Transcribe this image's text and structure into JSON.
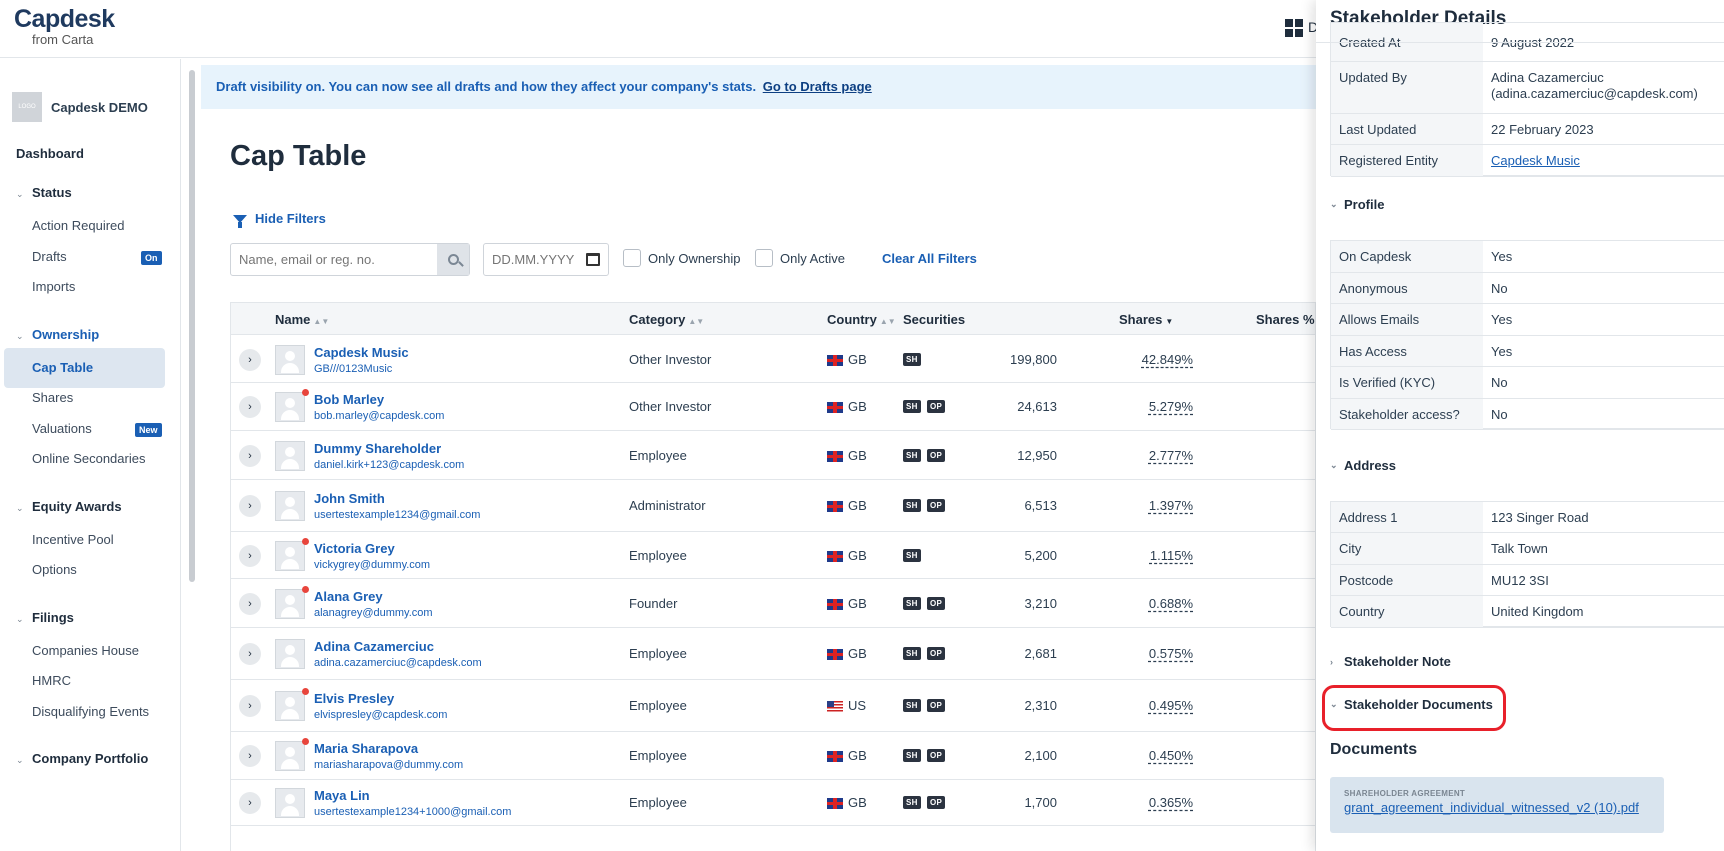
{
  "header": {
    "logo_main": "Capdesk",
    "logo_sub": "from Carta",
    "dash_label": "D"
  },
  "sidebar": {
    "company_logo": "LOGO",
    "company_name": "Capdesk DEMO",
    "dashboard": "Dashboard",
    "status": "Status",
    "action_required": "Action Required",
    "drafts": "Drafts",
    "drafts_badge": "On",
    "imports": "Imports",
    "ownership": "Ownership",
    "cap_table": "Cap Table",
    "shares": "Shares",
    "valuations": "Valuations",
    "valuations_badge": "New",
    "online_secondaries": "Online Secondaries",
    "equity_awards": "Equity Awards",
    "incentive_pool": "Incentive Pool",
    "options": "Options",
    "filings": "Filings",
    "companies_house": "Companies House",
    "hmrc": "HMRC",
    "disqualifying_events": "Disqualifying Events",
    "company_portfolio": "Company Portfolio"
  },
  "banner": {
    "text": "Draft visibility on. You can now see all drafts and how they affect your company's stats.",
    "link": "Go to Drafts page"
  },
  "main": {
    "title": "Cap Table",
    "hide_filters": "Hide Filters",
    "search_placeholder": "Name, email or reg. no.",
    "date_placeholder": "DD.MM.YYYY",
    "only_ownership": "Only Ownership",
    "only_active": "Only Active",
    "clear_filters": "Clear All Filters"
  },
  "table": {
    "columns": {
      "name": "Name",
      "category": "Category",
      "country": "Country",
      "securities": "Securities",
      "shares": "Shares",
      "shares_pct": "Shares %"
    },
    "rows": [
      {
        "name": "Capdesk Music",
        "sub": "GB///0123Music",
        "category": "Other Investor",
        "country": "GB",
        "secs": [
          "SH"
        ],
        "shares": "199,800",
        "pct": "42.849%"
      },
      {
        "name": "Bob Marley",
        "sub": "bob.marley@capdesk.com",
        "category": "Other Investor",
        "country": "GB",
        "secs": [
          "SH",
          "OP"
        ],
        "shares": "24,613",
        "pct": "5.279%"
      },
      {
        "name": "Dummy Shareholder",
        "sub": "daniel.kirk+123@capdesk.com",
        "category": "Employee",
        "country": "GB",
        "secs": [
          "SH",
          "OP"
        ],
        "shares": "12,950",
        "pct": "2.777%"
      },
      {
        "name": "John Smith",
        "sub": "usertestexample1234@gmail.com",
        "category": "Administrator",
        "country": "GB",
        "secs": [
          "SH",
          "OP"
        ],
        "shares": "6,513",
        "pct": "1.397%"
      },
      {
        "name": "Victoria Grey",
        "sub": "vickygrey@dummy.com",
        "category": "Employee",
        "country": "GB",
        "secs": [
          "SH"
        ],
        "shares": "5,200",
        "pct": "1.115%"
      },
      {
        "name": "Alana Grey",
        "sub": "alanagrey@dummy.com",
        "category": "Founder",
        "country": "GB",
        "secs": [
          "SH",
          "OP"
        ],
        "shares": "3,210",
        "pct": "0.688%"
      },
      {
        "name": "Adina Cazamerciuc",
        "sub": "adina.cazamerciuc@capdesk.com",
        "category": "Employee",
        "country": "GB",
        "secs": [
          "SH",
          "OP"
        ],
        "shares": "2,681",
        "pct": "0.575%"
      },
      {
        "name": "Elvis Presley",
        "sub": "elvispresley@capdesk.com",
        "category": "Employee",
        "country": "US",
        "secs": [
          "SH",
          "OP"
        ],
        "shares": "2,310",
        "pct": "0.495%"
      },
      {
        "name": "Maria Sharapova",
        "sub": "mariasharapova@dummy.com",
        "category": "Employee",
        "country": "GB",
        "secs": [
          "SH",
          "OP"
        ],
        "shares": "2,100",
        "pct": "0.450%"
      },
      {
        "name": "Maya Lin",
        "sub": "usertestexample1234+1000@gmail.com",
        "category": "Employee",
        "country": "GB",
        "secs": [
          "SH",
          "OP"
        ],
        "shares": "1,700",
        "pct": "0.365%"
      }
    ]
  },
  "panel": {
    "title": "Stakeholder Details",
    "top_rows": [
      {
        "k": "Created At",
        "v": "9 August 2022"
      },
      {
        "k": "Updated By",
        "v": "Adina Cazamerciuc",
        "v2": "(adina.cazamerciuc@capdesk.com)"
      },
      {
        "k": "Last Updated",
        "v": "22 February 2023"
      },
      {
        "k": "Registered Entity",
        "v": "Capdesk Music"
      }
    ],
    "profile_label": "Profile",
    "profile_rows": [
      {
        "k": "On Capdesk",
        "v": "Yes"
      },
      {
        "k": "Anonymous",
        "v": "No"
      },
      {
        "k": "Allows Emails",
        "v": "Yes"
      },
      {
        "k": "Has Access",
        "v": "Yes"
      },
      {
        "k": "Is Verified (KYC)",
        "v": "No"
      },
      {
        "k": "Stakeholder access?",
        "v": "No"
      }
    ],
    "address_label": "Address",
    "address_rows": [
      {
        "k": "Address 1",
        "v": "123 Singer Road"
      },
      {
        "k": "City",
        "v": "Talk Town"
      },
      {
        "k": "Postcode",
        "v": "MU12 3SI"
      },
      {
        "k": "Country",
        "v": "United Kingdom"
      }
    ],
    "note_label": "Stakeholder Note",
    "docs_label": "Stakeholder Documents",
    "documents_title": "Documents",
    "doc_type": "SHAREHOLDER AGREEMENT",
    "doc_file": "grant_agreement_individual_witnessed_v2 (10).pdf"
  }
}
